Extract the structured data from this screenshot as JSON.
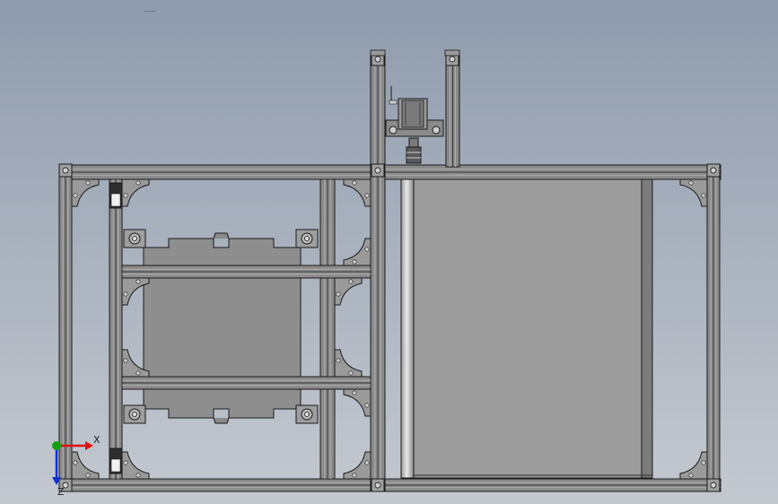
{
  "viewport": {
    "background_top": "#8f9bad",
    "background_bottom": "#c4c9d0",
    "view_mode": "shaded-with-edges"
  },
  "colors": {
    "frame_face": "#8a8a8a",
    "frame_light": "#b0b0b0",
    "frame_dark": "#3a3a3a",
    "edge": "#1a1a1a",
    "panel": "#9c9c9c",
    "plate": "#8e8e8e",
    "rod_light": "#e6e6e6",
    "axis_x": "#e01010",
    "axis_y": "#10a010",
    "axis_z": "#1030d0"
  },
  "model": {
    "parts": [
      "aluminum-extrusion-frame",
      "stepper-motor",
      "shaft-coupling",
      "corner-bracket",
      "xy-carriage-plate",
      "sliding-panel",
      "linear-rod",
      "linear-bearing-block"
    ]
  },
  "triad": {
    "x_label": "X",
    "z_label": "Z"
  }
}
